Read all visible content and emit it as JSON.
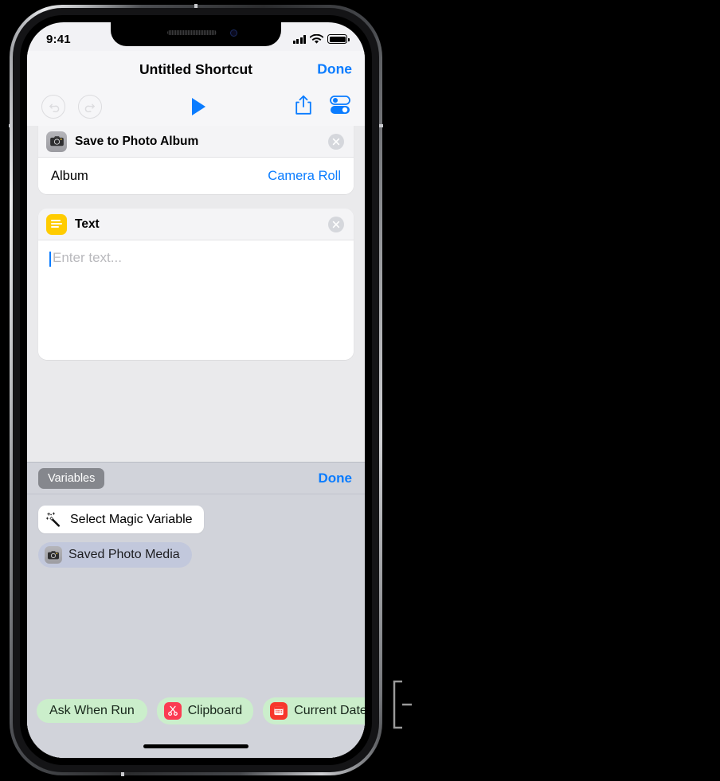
{
  "status_bar": {
    "time": "9:41",
    "icons": [
      "cellular-signal-icon",
      "wifi-icon",
      "battery-icon"
    ]
  },
  "nav_bar": {
    "title": "Untitled Shortcut",
    "done_label": "Done"
  },
  "toolbar": {
    "undo_icon": "undo-icon",
    "redo_icon": "redo-icon",
    "play_icon": "play-icon",
    "share_icon": "share-icon",
    "settings_icon": "toggles-settings-icon"
  },
  "actions": [
    {
      "title": "Save to Photo Album",
      "icon": "camera-icon",
      "close_icon": "close-icon",
      "rows": [
        {
          "label": "Album",
          "value": "Camera Roll"
        }
      ]
    },
    {
      "title": "Text",
      "icon": "text-lines-icon",
      "close_icon": "close-icon",
      "text_value": "",
      "text_placeholder": "Enter text..."
    }
  ],
  "variables_panel": {
    "pill_label": "Variables",
    "done_label": "Done",
    "magic_variable": {
      "label": "Select Magic Variable",
      "icon": "magic-wand-icon"
    },
    "items": [
      {
        "label": "Saved Photo Media",
        "icon": "camera-icon"
      }
    ]
  },
  "suggestion_chips": [
    {
      "label": "Ask When Run",
      "icon": null
    },
    {
      "label": "Clipboard",
      "icon": "scissors-icon"
    },
    {
      "label": "Current Date",
      "icon": "calendar-icon"
    }
  ],
  "colors": {
    "accent_blue": "#0a7cff",
    "chip_green": "#cbeecb",
    "panel_gray": "#d1d3da",
    "text_icon_yellow": "#ffcc00",
    "clipboard_red": "#fb3b52",
    "calendar_red": "#f7372c"
  }
}
